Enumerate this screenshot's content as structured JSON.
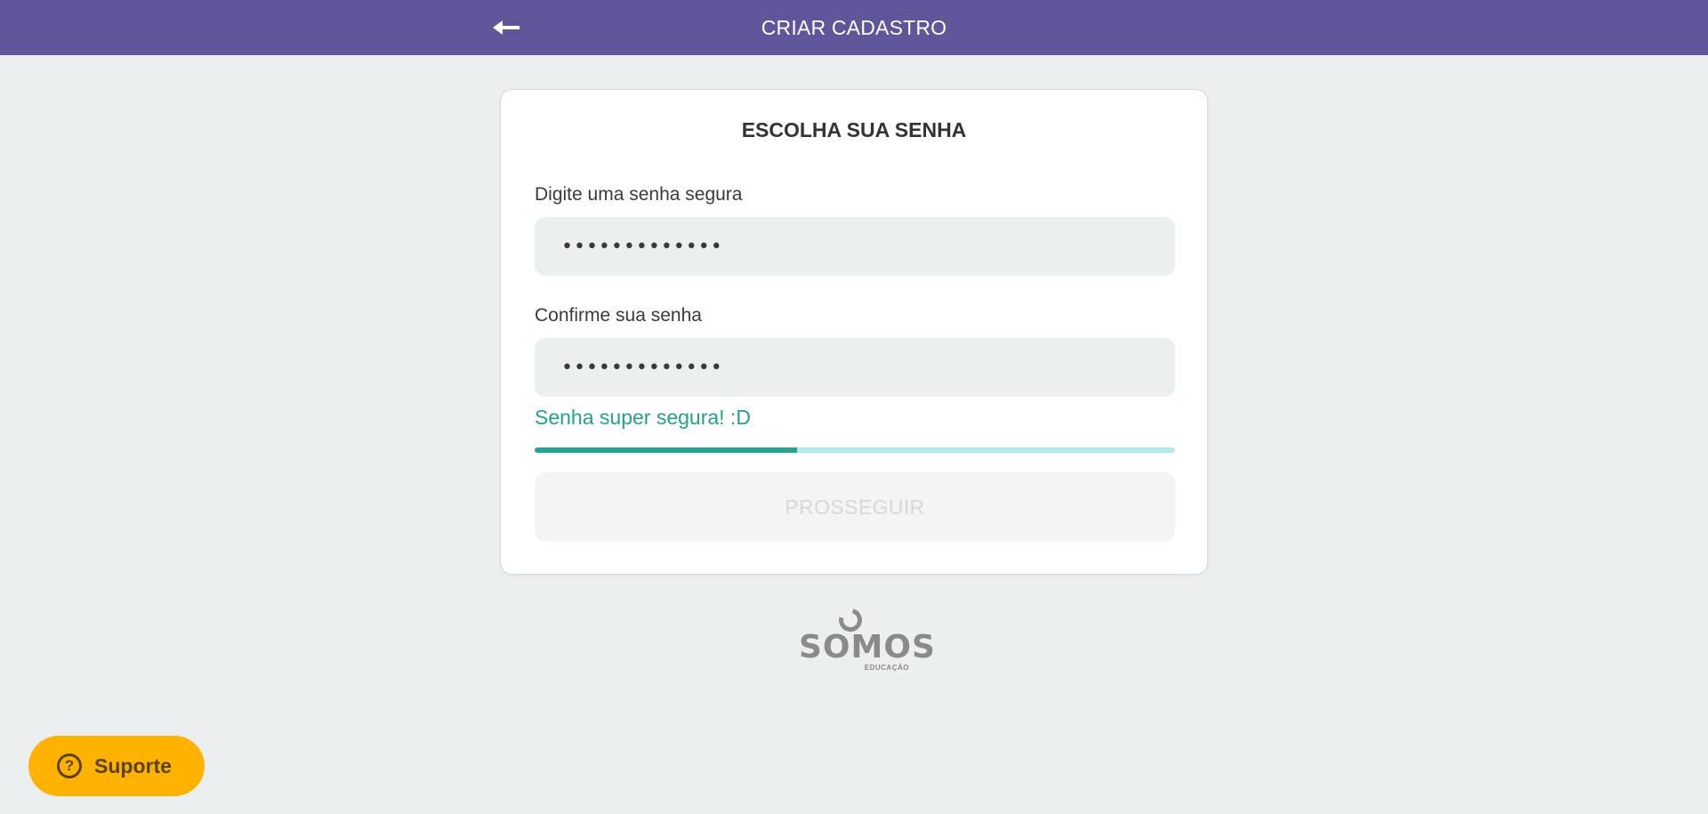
{
  "header": {
    "title": "CRIAR CADASTRO",
    "back_icon": "arrow-left-icon",
    "background_color": "#5f5599"
  },
  "card": {
    "title": "ESCOLHA SUA SENHA",
    "password_field": {
      "label": "Digite uma senha segura",
      "value": "•••••••••••••"
    },
    "confirm_field": {
      "label": "Confirme sua senha",
      "value": "•••••••••••••"
    },
    "strength": {
      "text": "Senha super segura! :D",
      "level_fraction": 0.41,
      "color": "#25a08a",
      "track_color": "#b3eae6"
    },
    "proceed_button": {
      "label": "PROSSEGUIR",
      "disabled": true
    }
  },
  "logo": {
    "name": "SOMOS",
    "sub": "EDUCAÇÃO"
  },
  "support": {
    "label": "Suporte",
    "icon": "question-circle-icon",
    "icon_glyph": "?",
    "color": "#ffb300"
  }
}
